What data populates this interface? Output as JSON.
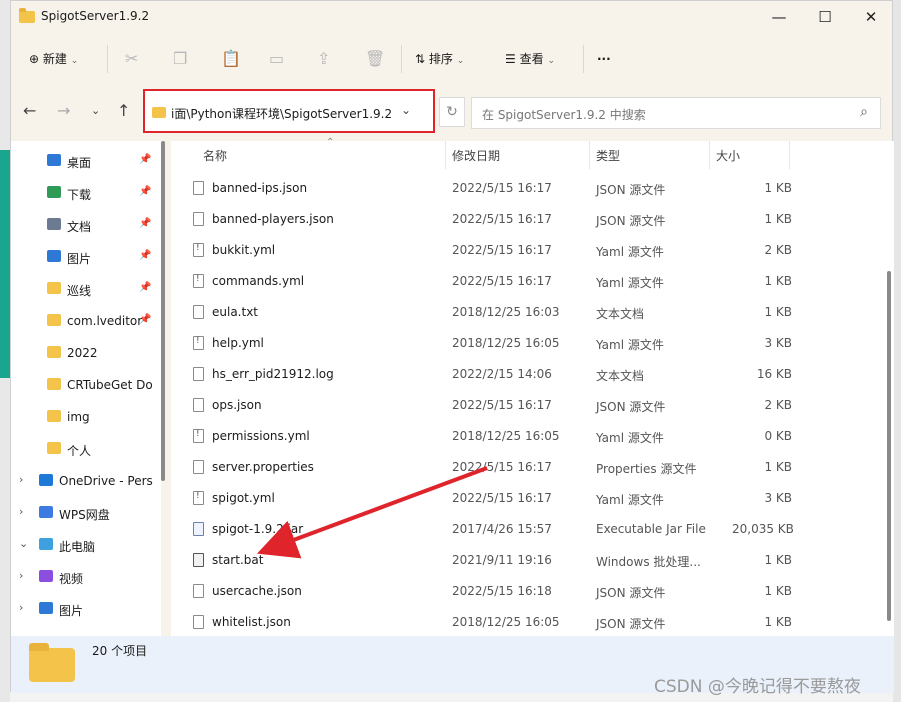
{
  "window": {
    "title": "SpigotServer1.9.2"
  },
  "toolbar": {
    "new_label": "新建",
    "sort_label": "排序",
    "view_label": "查看",
    "more": "···"
  },
  "address": {
    "path": "i面\\Python课程环境\\SpigotServer1.9.2"
  },
  "search": {
    "placeholder": "在 SpigotServer1.9.2 中搜索"
  },
  "sidebar": {
    "items": [
      {
        "label": "桌面",
        "pinned": true,
        "icon": "desktop-icon",
        "color": "#2f79d6"
      },
      {
        "label": "下载",
        "pinned": true,
        "icon": "download-icon",
        "color": "#2f9b57"
      },
      {
        "label": "文档",
        "pinned": true,
        "icon": "document-icon",
        "color": "#6c7b91"
      },
      {
        "label": "图片",
        "pinned": true,
        "icon": "picture-icon",
        "color": "#2f79d6"
      },
      {
        "label": "巡线",
        "pinned": true,
        "icon": "folder-icon",
        "color": "#f3c449"
      },
      {
        "label": "com.lveditor",
        "pinned": true,
        "icon": "folder-icon",
        "color": "#f3c449"
      },
      {
        "label": "2022",
        "pinned": false,
        "icon": "folder-icon",
        "color": "#f3c449"
      },
      {
        "label": "CRTubeGet Do",
        "pinned": false,
        "icon": "folder-icon",
        "color": "#f3c449"
      },
      {
        "label": "img",
        "pinned": false,
        "icon": "folder-icon",
        "color": "#f3c449"
      },
      {
        "label": "个人",
        "pinned": false,
        "icon": "folder-icon",
        "color": "#f3c449"
      },
      {
        "label": "OneDrive - Pers",
        "pinned": false,
        "icon": "cloud-icon",
        "color": "#1e78d7",
        "chevron": "›"
      },
      {
        "label": "WPS网盘",
        "pinned": false,
        "icon": "cloud-icon",
        "color": "#3d7be0",
        "chevron": "›"
      },
      {
        "label": "此电脑",
        "pinned": false,
        "icon": "computer-icon",
        "color": "#3fa0e0",
        "chevron": "⌄"
      },
      {
        "label": "视频",
        "pinned": false,
        "icon": "video-icon",
        "color": "#8a4fe0",
        "chevron": "›"
      },
      {
        "label": "图片",
        "pinned": false,
        "icon": "picture-icon",
        "color": "#2f79d6",
        "chevron": "›"
      }
    ]
  },
  "columns": {
    "name": "名称",
    "date": "修改日期",
    "type": "类型",
    "size": "大小"
  },
  "files": [
    {
      "name": "banned-ips.json",
      "date": "2022/5/15 16:17",
      "type": "JSON 源文件",
      "size": "1 KB",
      "kind": "json"
    },
    {
      "name": "banned-players.json",
      "date": "2022/5/15 16:17",
      "type": "JSON 源文件",
      "size": "1 KB",
      "kind": "json"
    },
    {
      "name": "bukkit.yml",
      "date": "2022/5/15 16:17",
      "type": "Yaml 源文件",
      "size": "2 KB",
      "kind": "yml"
    },
    {
      "name": "commands.yml",
      "date": "2022/5/15 16:17",
      "type": "Yaml 源文件",
      "size": "1 KB",
      "kind": "yml"
    },
    {
      "name": "eula.txt",
      "date": "2018/12/25 16:03",
      "type": "文本文档",
      "size": "1 KB",
      "kind": "txt"
    },
    {
      "name": "help.yml",
      "date": "2018/12/25 16:05",
      "type": "Yaml 源文件",
      "size": "3 KB",
      "kind": "yml"
    },
    {
      "name": "hs_err_pid21912.log",
      "date": "2022/2/15 14:06",
      "type": "文本文档",
      "size": "16 KB",
      "kind": "txt"
    },
    {
      "name": "ops.json",
      "date": "2022/5/15 16:17",
      "type": "JSON 源文件",
      "size": "2 KB",
      "kind": "json"
    },
    {
      "name": "permissions.yml",
      "date": "2018/12/25 16:05",
      "type": "Yaml 源文件",
      "size": "0 KB",
      "kind": "yml"
    },
    {
      "name": "server.properties",
      "date": "2022/5/15 16:17",
      "type": "Properties 源文件",
      "size": "1 KB",
      "kind": "txt"
    },
    {
      "name": "spigot.yml",
      "date": "2022/5/15 16:17",
      "type": "Yaml 源文件",
      "size": "3 KB",
      "kind": "yml"
    },
    {
      "name": "spigot-1.9.2.jar",
      "date": "2017/4/26 15:57",
      "type": "Executable Jar File",
      "size": "20,035 KB",
      "kind": "jar"
    },
    {
      "name": "start.bat",
      "date": "2021/9/11 19:16",
      "type": "Windows 批处理...",
      "size": "1 KB",
      "kind": "bat"
    },
    {
      "name": "usercache.json",
      "date": "2022/5/15 16:18",
      "type": "JSON 源文件",
      "size": "1 KB",
      "kind": "json"
    },
    {
      "name": "whitelist.json",
      "date": "2018/12/25 16:05",
      "type": "JSON 源文件",
      "size": "1 KB",
      "kind": "json"
    }
  ],
  "status": {
    "count": "20 个项目"
  },
  "watermark": "CSDN @今晚记得不要熬夜",
  "annotation": {
    "highlight_color": "#e0242b",
    "arrow_color": "#e0242b"
  }
}
